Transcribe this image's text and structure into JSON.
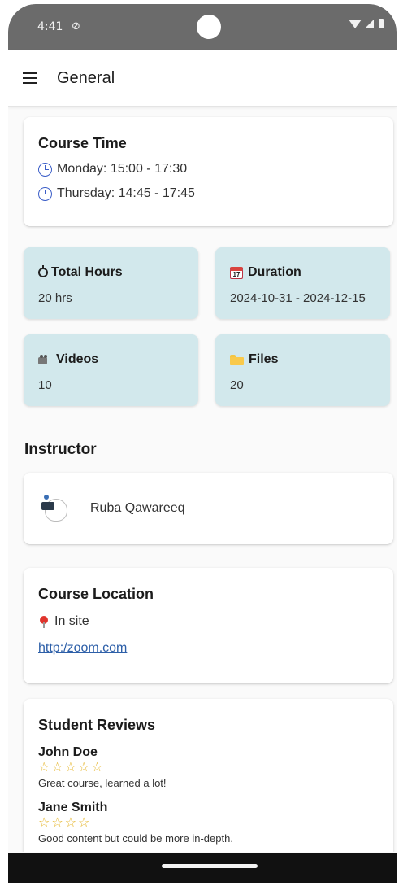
{
  "status_bar": {
    "time": "4:41",
    "dnd_icon": "do-not-disturb-icon",
    "icons": [
      "wifi-icon",
      "signal-icon",
      "battery-icon"
    ]
  },
  "app_bar": {
    "title": "General",
    "menu_icon": "hamburger-menu-icon"
  },
  "course_time": {
    "title": "Course Time",
    "schedule": [
      {
        "day": "Monday: 15:00 - 17:30"
      },
      {
        "day": "Thursday: 14:45 - 17:45"
      }
    ]
  },
  "stats": {
    "total_hours": {
      "label": "Total Hours",
      "value": "20 hrs",
      "icon": "stopwatch-icon"
    },
    "duration": {
      "label": "Duration",
      "value": "2024-10-31 - 2024-12-15",
      "icon": "calendar-icon",
      "icon_text": "17"
    },
    "videos": {
      "label": "Videos",
      "value": "10",
      "icon": "video-camera-icon"
    },
    "files": {
      "label": "Files",
      "value": "20",
      "icon": "folder-icon"
    }
  },
  "instructor": {
    "heading": "Instructor",
    "name": "Ruba Qawareeq"
  },
  "location": {
    "title": "Course Location",
    "mode": "In site",
    "link": "http:/zoom.com"
  },
  "reviews": {
    "title": "Student Reviews",
    "items": [
      {
        "name": "John Doe",
        "stars": 5,
        "text": "Great course, learned a lot!"
      },
      {
        "name": "Jane Smith",
        "stars": 4,
        "text": "Good content but could be more in-depth."
      }
    ]
  },
  "colors": {
    "tile_bg": "#d2e8ec",
    "link": "#2d5fa8",
    "star": "#e5b52a",
    "status_bar": "#6b6b6b"
  }
}
